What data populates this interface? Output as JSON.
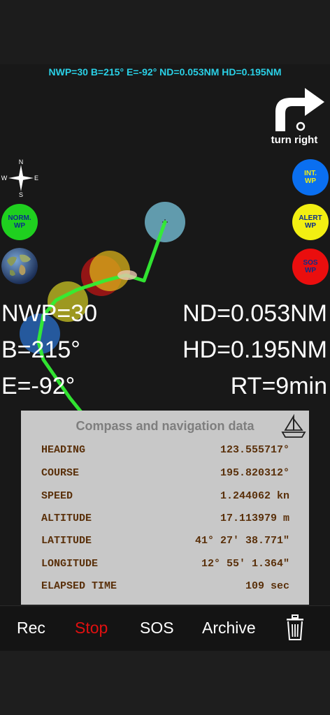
{
  "status_line": "NWP=30 B=215° E=-92° ND=0.053NM HD=0.195NM",
  "turn": {
    "label": "turn right"
  },
  "compass": {
    "n": "N",
    "s": "S",
    "e": "E",
    "w": "W"
  },
  "waypoint_buttons": {
    "normal": {
      "line1": "NORM.",
      "line2": "WP",
      "color": "#1fd01f"
    },
    "intermediate": {
      "line1": "INT.",
      "line2": "WP",
      "color": "#0a6ff0"
    },
    "alert": {
      "line1": "ALERT",
      "line2": "WP",
      "color": "#f2ef12"
    },
    "sos": {
      "line1": "SOS",
      "line2": "WP",
      "color": "#ea0e0e"
    }
  },
  "nav": {
    "nwp": "NWP=30",
    "bearing": "B=215°",
    "error": "E=-92°",
    "nd": "ND=0.053NM",
    "hd": "HD=0.195NM",
    "rt": "RT=9min"
  },
  "panel": {
    "title": "Compass and navigation data",
    "rows": [
      {
        "label": "HEADING",
        "value": "123.555717°"
      },
      {
        "label": "COURSE",
        "value": "195.820312°"
      },
      {
        "label": "SPEED",
        "value": "1.244062 kn"
      },
      {
        "label": "ALTITUDE",
        "value": "17.113979 m"
      },
      {
        "label": "LATITUDE",
        "value": "41° 27' 38.771\""
      },
      {
        "label": "LONGITUDE",
        "value": "12° 55' 1.364\""
      },
      {
        "label": "ELAPSED TIME",
        "value": "109 sec"
      }
    ]
  },
  "toolbar": {
    "rec": "Rec",
    "stop": "Stop",
    "sos": "SOS",
    "archive": "Archive",
    "stop_color": "#e01010"
  },
  "colors": {
    "track": "#33ee33",
    "status": "#2ad0e6",
    "text_brown": "#5a300a"
  }
}
